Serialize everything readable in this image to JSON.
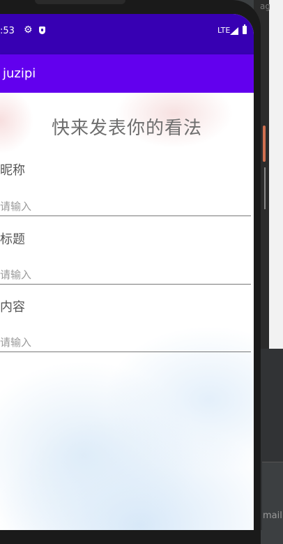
{
  "ide": {
    "top_label": "ag",
    "bottom_label": "mail"
  },
  "status_bar": {
    "time": ":53",
    "network": "LTE"
  },
  "app_bar": {
    "title": "juzipi"
  },
  "form": {
    "heading": "快来发表你的看法",
    "fields": [
      {
        "label": "昵称",
        "placeholder": "请输入",
        "value": ""
      },
      {
        "label": "标题",
        "placeholder": "请输入",
        "value": ""
      },
      {
        "label": "内容",
        "placeholder": "请输入",
        "value": ""
      }
    ]
  },
  "colors": {
    "status_bar": "#3700b3",
    "app_bar": "#6200ee"
  }
}
